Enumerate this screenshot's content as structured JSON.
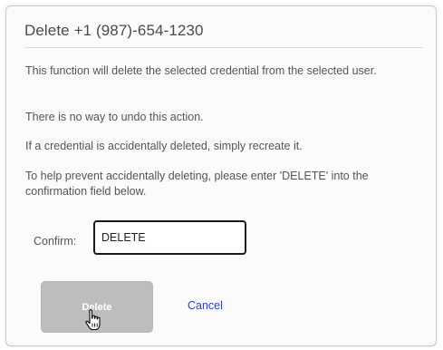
{
  "dialog": {
    "title": "Delete +1 (987)-654-1230",
    "messages": [
      "This function will delete the selected credential from the selected user.",
      "There is no way to undo this action.",
      "If a credential is accidentally deleted, simply recreate it.",
      "To help prevent accidentally deleting, please enter 'DELETE' into the confirmation field below."
    ],
    "confirm": {
      "label": "Confirm:",
      "value": "DELETE"
    },
    "buttons": {
      "delete_label": "Delete",
      "cancel_label": "Cancel"
    }
  },
  "colors": {
    "delete_button_disabled": "#bdbdbd",
    "cancel_link": "#2b44c8",
    "input_border": "#1a1a1a"
  },
  "icons": {
    "cursor": "hand-pointer-icon"
  }
}
